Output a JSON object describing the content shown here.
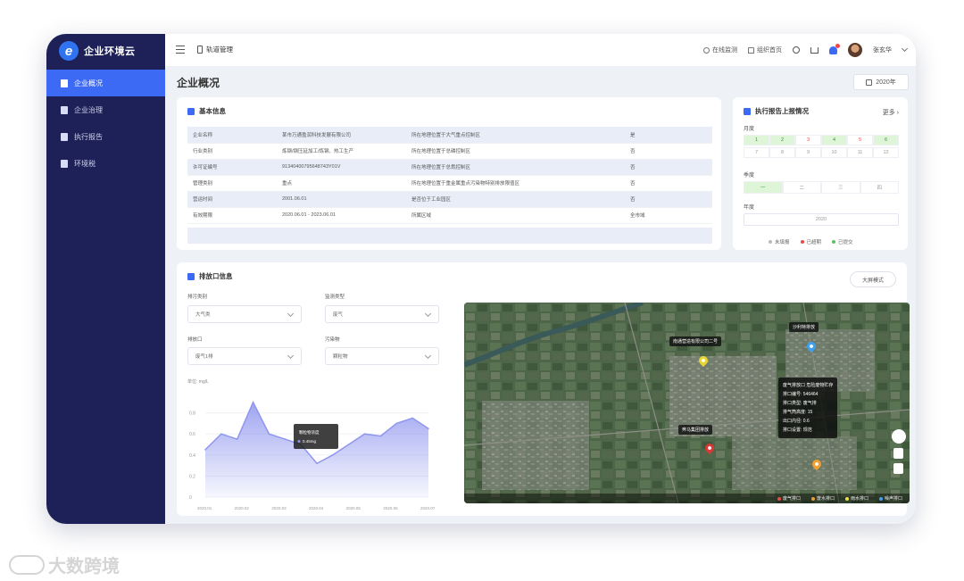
{
  "brand": {
    "name": "企业环境云",
    "logo_letter": "e"
  },
  "nav": [
    {
      "label": "企业概况",
      "active": true
    },
    {
      "label": "企业治理",
      "active": false
    },
    {
      "label": "执行报告",
      "active": false
    },
    {
      "label": "环境税",
      "active": false
    }
  ],
  "topbar": {
    "breadcrumb": "轨道管理",
    "links": [
      "在线监测",
      "组织首页"
    ],
    "user": "张玄华"
  },
  "page": {
    "title": "企业概况",
    "year": "2020年"
  },
  "basic_info": {
    "title": "基本信息",
    "rows": [
      [
        "企业名称",
        "某市万通盈润科技发展有限公司",
        "所在地理位置于大气重点控制区",
        "是"
      ],
      [
        "行业类别",
        "炼钢/钢压延加工/炼钢、热工生产",
        "所在地理位置于总磷控制区",
        "否"
      ],
      [
        "许可证编号",
        "91340400795648743Y01V",
        "所在地理位置于总氮控制区",
        "否"
      ],
      [
        "管理类别",
        "重点",
        "所在地理位置于重金属重点污染物特别排放限值区",
        "否"
      ],
      [
        "营运时间",
        "2001.06.01",
        "是否位于工业园区",
        "否"
      ],
      [
        "有效期限",
        "2020.06.01 - 2023.06.01",
        "所属区域",
        "全市域"
      ]
    ]
  },
  "report_status": {
    "title": "执行报告上报情况",
    "more": "更多",
    "month_label": "月度",
    "months_row1": [
      "1",
      "2",
      "3",
      "4",
      "5",
      "6"
    ],
    "months_row1_state": [
      "ok",
      "ok",
      "late",
      "ok",
      "late",
      "ok"
    ],
    "months_row2": [
      "7",
      "8",
      "9",
      "10",
      "11",
      "12"
    ],
    "quarter_label": "季度",
    "quarters": [
      "一",
      "二",
      "三",
      "四"
    ],
    "quarters_state": [
      "ok",
      "",
      "",
      ""
    ],
    "year_label": "年度",
    "year_value": "2020",
    "legend": [
      {
        "label": "未填报",
        "color": "#bbbbbb"
      },
      {
        "label": "已超期",
        "color": "#f04848"
      },
      {
        "label": "已提交",
        "color": "#5cc45c"
      }
    ]
  },
  "outlet": {
    "title": "排放口信息",
    "big_button": "大屏模式",
    "filters": [
      {
        "label": "排污类别",
        "value": "大气类"
      },
      {
        "label": "监测类型",
        "value": "废气"
      },
      {
        "label": "排放口",
        "value": "废气1排"
      },
      {
        "label": "污染物",
        "value": "颗粒物"
      }
    ],
    "chart_unit": "单位: mg/L"
  },
  "chart_data": {
    "type": "area",
    "x": [
      "2020.01",
      "2020.02",
      "2020.03",
      "2020.04",
      "2020.05",
      "2020.06",
      "2020.07"
    ],
    "values": [
      0.45,
      0.6,
      0.55,
      0.9,
      0.6,
      0.55,
      0.5,
      0.32,
      0.4,
      0.5,
      0.6,
      0.58,
      0.7,
      0.75,
      0.65
    ],
    "yticks": [
      "0",
      "0.2",
      "0.4",
      "0.6",
      "0.8"
    ],
    "ylim": [
      0,
      1
    ],
    "tooltip": {
      "title": "颗粒物浓度",
      "value": "0.45mg"
    },
    "color": "#8f96ee"
  },
  "map": {
    "labels": [
      "南通营造有限公司二号",
      "沙利特排放",
      "奔马集团排放"
    ],
    "popup": [
      "废气排放口 危险废物贮存",
      "排口编号: 546464",
      "排口类型: 废气排",
      "排气筒高度: 15",
      "出口内径: 0.6",
      "排口设置: 规范"
    ],
    "legend": [
      {
        "label": "废气排口",
        "color": "#f04848"
      },
      {
        "label": "废水排口",
        "color": "#f0a030"
      },
      {
        "label": "雨水排口",
        "color": "#f0e040"
      },
      {
        "label": "噪声排口",
        "color": "#40a0f0"
      }
    ]
  },
  "watermark": "大数跨境"
}
